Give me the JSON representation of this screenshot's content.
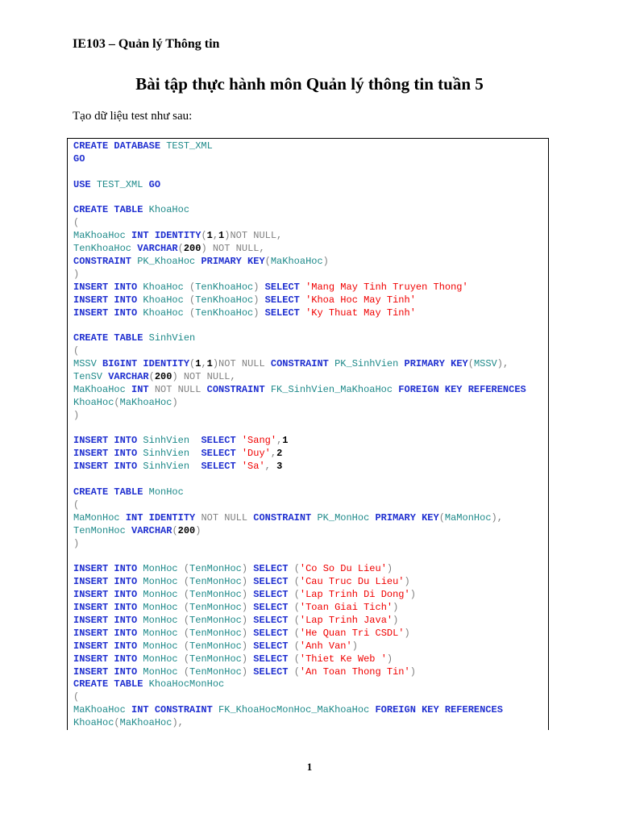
{
  "header": "IE103 – Quản lý Thông tin",
  "title": "Bài tập thực hành môn Quản lý thông tin tuần 5",
  "intro": "Tạo dữ liệu test như sau:",
  "page_number": "1",
  "code": {
    "lines": [
      [
        [
          "k",
          "CREATE DATABASE "
        ],
        [
          "i",
          "TEST_XML"
        ]
      ],
      [
        [
          "k",
          "GO"
        ]
      ],
      [],
      [
        [
          "k",
          "USE "
        ],
        [
          "i",
          "TEST_XML "
        ],
        [
          "k",
          "GO"
        ]
      ],
      [],
      [
        [
          "k",
          "CREATE TABLE "
        ],
        [
          "i",
          "KhoaHoc"
        ]
      ],
      [
        [
          "g",
          "("
        ]
      ],
      [
        [
          "i",
          "MaKhoaHoc "
        ],
        [
          "k",
          "INT IDENTITY"
        ],
        [
          "g",
          "("
        ],
        [
          "n",
          "1"
        ],
        [
          "g",
          ","
        ],
        [
          "n",
          "1"
        ],
        [
          "g",
          ")NOT NULL,"
        ]
      ],
      [
        [
          "i",
          "TenKhoaHoc "
        ],
        [
          "k",
          "VARCHAR"
        ],
        [
          "g",
          "("
        ],
        [
          "n",
          "200"
        ],
        [
          "g",
          ") NOT NULL,"
        ]
      ],
      [
        [
          "k",
          "CONSTRAINT "
        ],
        [
          "i",
          "PK_KhoaHoc "
        ],
        [
          "k",
          "PRIMARY KEY"
        ],
        [
          "g",
          "("
        ],
        [
          "i",
          "MaKhoaHoc"
        ],
        [
          "g",
          ")"
        ]
      ],
      [
        [
          "g",
          ")"
        ]
      ],
      [
        [
          "k",
          "INSERT INTO "
        ],
        [
          "i",
          "KhoaHoc "
        ],
        [
          "g",
          "("
        ],
        [
          "i",
          "TenKhoaHoc"
        ],
        [
          "g",
          ") "
        ],
        [
          "k",
          "SELECT "
        ],
        [
          "s",
          "'Mang May Tinh Truyen Thong'"
        ]
      ],
      [
        [
          "k",
          "INSERT INTO "
        ],
        [
          "i",
          "KhoaHoc "
        ],
        [
          "g",
          "("
        ],
        [
          "i",
          "TenKhoaHoc"
        ],
        [
          "g",
          ") "
        ],
        [
          "k",
          "SELECT "
        ],
        [
          "s",
          "'Khoa Hoc May Tinh'"
        ]
      ],
      [
        [
          "k",
          "INSERT INTO "
        ],
        [
          "i",
          "KhoaHoc "
        ],
        [
          "g",
          "("
        ],
        [
          "i",
          "TenKhoaHoc"
        ],
        [
          "g",
          ") "
        ],
        [
          "k",
          "SELECT "
        ],
        [
          "s",
          "'Ky Thuat May Tinh'"
        ]
      ],
      [],
      [
        [
          "k",
          "CREATE TABLE "
        ],
        [
          "i",
          "SinhVien"
        ]
      ],
      [
        [
          "g",
          "("
        ]
      ],
      [
        [
          "i",
          "MSSV "
        ],
        [
          "k",
          "BIGINT IDENTITY"
        ],
        [
          "g",
          "("
        ],
        [
          "n",
          "1"
        ],
        [
          "g",
          ","
        ],
        [
          "n",
          "1"
        ],
        [
          "g",
          ")NOT NULL "
        ],
        [
          "k",
          "CONSTRAINT "
        ],
        [
          "i",
          "PK_SinhVien "
        ],
        [
          "k",
          "PRIMARY KEY"
        ],
        [
          "g",
          "("
        ],
        [
          "i",
          "MSSV"
        ],
        [
          "g",
          "),"
        ]
      ],
      [
        [
          "i",
          "TenSV "
        ],
        [
          "k",
          "VARCHAR"
        ],
        [
          "g",
          "("
        ],
        [
          "n",
          "200"
        ],
        [
          "g",
          ") NOT NULL,"
        ]
      ],
      [
        [
          "i",
          "MaKhoaHoc "
        ],
        [
          "k",
          "INT "
        ],
        [
          "g",
          "NOT NULL "
        ],
        [
          "k",
          "CONSTRAINT "
        ],
        [
          "i",
          "FK_SinhVien_MaKhoaHoc "
        ],
        [
          "k",
          "FOREIGN KEY REFERENCES"
        ]
      ],
      [
        [
          "i",
          "KhoaHoc"
        ],
        [
          "g",
          "("
        ],
        [
          "i",
          "MaKhoaHoc"
        ],
        [
          "g",
          ")"
        ]
      ],
      [
        [
          "g",
          ")"
        ]
      ],
      [],
      [
        [
          "k",
          "INSERT INTO "
        ],
        [
          "i",
          "SinhVien  "
        ],
        [
          "k",
          "SELECT "
        ],
        [
          "s",
          "'Sang'"
        ],
        [
          "g",
          ","
        ],
        [
          "n",
          "1"
        ]
      ],
      [
        [
          "k",
          "INSERT INTO "
        ],
        [
          "i",
          "SinhVien  "
        ],
        [
          "k",
          "SELECT "
        ],
        [
          "s",
          "'Duy'"
        ],
        [
          "g",
          ","
        ],
        [
          "n",
          "2"
        ]
      ],
      [
        [
          "k",
          "INSERT INTO "
        ],
        [
          "i",
          "SinhVien  "
        ],
        [
          "k",
          "SELECT "
        ],
        [
          "s",
          "'Sa'"
        ],
        [
          "g",
          ", "
        ],
        [
          "n",
          "3"
        ]
      ],
      [],
      [
        [
          "k",
          "CREATE TABLE "
        ],
        [
          "i",
          "MonHoc"
        ]
      ],
      [
        [
          "g",
          "("
        ]
      ],
      [
        [
          "i",
          "MaMonHoc "
        ],
        [
          "k",
          "INT IDENTITY "
        ],
        [
          "g",
          "NOT NULL "
        ],
        [
          "k",
          "CONSTRAINT "
        ],
        [
          "i",
          "PK_MonHoc "
        ],
        [
          "k",
          "PRIMARY KEY"
        ],
        [
          "g",
          "("
        ],
        [
          "i",
          "MaMonHoc"
        ],
        [
          "g",
          "),"
        ]
      ],
      [
        [
          "i",
          "TenMonHoc "
        ],
        [
          "k",
          "VARCHAR"
        ],
        [
          "g",
          "("
        ],
        [
          "n",
          "200"
        ],
        [
          "g",
          ")"
        ]
      ],
      [
        [
          "g",
          ")"
        ]
      ],
      [],
      [
        [
          "k",
          "INSERT INTO "
        ],
        [
          "i",
          "MonHoc "
        ],
        [
          "g",
          "("
        ],
        [
          "i",
          "TenMonHoc"
        ],
        [
          "g",
          ") "
        ],
        [
          "k",
          "SELECT "
        ],
        [
          "g",
          "("
        ],
        [
          "s",
          "'Co So Du Lieu'"
        ],
        [
          "g",
          ")"
        ]
      ],
      [
        [
          "k",
          "INSERT INTO "
        ],
        [
          "i",
          "MonHoc "
        ],
        [
          "g",
          "("
        ],
        [
          "i",
          "TenMonHoc"
        ],
        [
          "g",
          ") "
        ],
        [
          "k",
          "SELECT "
        ],
        [
          "g",
          "("
        ],
        [
          "s",
          "'Cau Truc Du Lieu'"
        ],
        [
          "g",
          ")"
        ]
      ],
      [
        [
          "k",
          "INSERT INTO "
        ],
        [
          "i",
          "MonHoc "
        ],
        [
          "g",
          "("
        ],
        [
          "i",
          "TenMonHoc"
        ],
        [
          "g",
          ") "
        ],
        [
          "k",
          "SELECT "
        ],
        [
          "g",
          "("
        ],
        [
          "s",
          "'Lap Trinh Di Dong'"
        ],
        [
          "g",
          ")"
        ]
      ],
      [
        [
          "k",
          "INSERT INTO "
        ],
        [
          "i",
          "MonHoc "
        ],
        [
          "g",
          "("
        ],
        [
          "i",
          "TenMonHoc"
        ],
        [
          "g",
          ") "
        ],
        [
          "k",
          "SELECT "
        ],
        [
          "g",
          "("
        ],
        [
          "s",
          "'Toan Giai Tich'"
        ],
        [
          "g",
          ")"
        ]
      ],
      [
        [
          "k",
          "INSERT INTO "
        ],
        [
          "i",
          "MonHoc "
        ],
        [
          "g",
          "("
        ],
        [
          "i",
          "TenMonHoc"
        ],
        [
          "g",
          ") "
        ],
        [
          "k",
          "SELECT "
        ],
        [
          "g",
          "("
        ],
        [
          "s",
          "'Lap Trinh Java'"
        ],
        [
          "g",
          ")"
        ]
      ],
      [
        [
          "k",
          "INSERT INTO "
        ],
        [
          "i",
          "MonHoc "
        ],
        [
          "g",
          "("
        ],
        [
          "i",
          "TenMonHoc"
        ],
        [
          "g",
          ") "
        ],
        [
          "k",
          "SELECT "
        ],
        [
          "g",
          "("
        ],
        [
          "s",
          "'He Quan Tri CSDL'"
        ],
        [
          "g",
          ")"
        ]
      ],
      [
        [
          "k",
          "INSERT INTO "
        ],
        [
          "i",
          "MonHoc "
        ],
        [
          "g",
          "("
        ],
        [
          "i",
          "TenMonHoc"
        ],
        [
          "g",
          ") "
        ],
        [
          "k",
          "SELECT "
        ],
        [
          "g",
          "("
        ],
        [
          "s",
          "'Anh Van'"
        ],
        [
          "g",
          ")"
        ]
      ],
      [
        [
          "k",
          "INSERT INTO "
        ],
        [
          "i",
          "MonHoc "
        ],
        [
          "g",
          "("
        ],
        [
          "i",
          "TenMonHoc"
        ],
        [
          "g",
          ") "
        ],
        [
          "k",
          "SELECT "
        ],
        [
          "g",
          "("
        ],
        [
          "s",
          "'Thiet Ke Web '"
        ],
        [
          "g",
          ")"
        ]
      ],
      [
        [
          "k",
          "INSERT INTO "
        ],
        [
          "i",
          "MonHoc "
        ],
        [
          "g",
          "("
        ],
        [
          "i",
          "TenMonHoc"
        ],
        [
          "g",
          ") "
        ],
        [
          "k",
          "SELECT "
        ],
        [
          "g",
          "("
        ],
        [
          "s",
          "'An Toan Thong Tin'"
        ],
        [
          "g",
          ")"
        ]
      ],
      [
        [
          "k",
          "CREATE TABLE "
        ],
        [
          "i",
          "KhoaHocMonHoc"
        ]
      ],
      [
        [
          "g",
          "("
        ]
      ],
      [
        [
          "i",
          "MaKhoaHoc "
        ],
        [
          "k",
          "INT CONSTRAINT "
        ],
        [
          "i",
          "FK_KhoaHocMonHoc_MaKhoaHoc "
        ],
        [
          "k",
          "FOREIGN KEY REFERENCES"
        ]
      ],
      [
        [
          "i",
          "KhoaHoc"
        ],
        [
          "g",
          "("
        ],
        [
          "i",
          "MaKhoaHoc"
        ],
        [
          "g",
          "),"
        ]
      ]
    ]
  }
}
